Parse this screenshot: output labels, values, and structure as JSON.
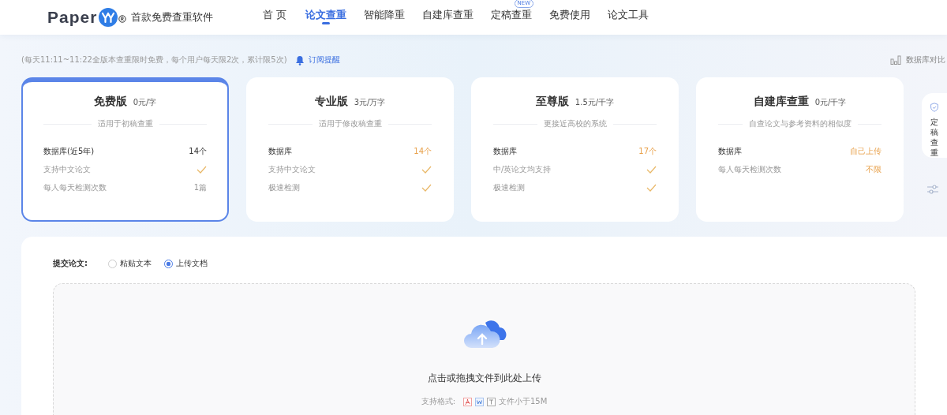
{
  "header": {
    "brand": "Paper",
    "tagline": "首款免费查重软件",
    "nav": [
      {
        "label": "首 页",
        "selected": false
      },
      {
        "label": "论文查重",
        "selected": true
      },
      {
        "label": "智能降重",
        "selected": false
      },
      {
        "label": "自建库查重",
        "selected": false
      },
      {
        "label": "定稿查重",
        "selected": false,
        "badge": "NEW"
      },
      {
        "label": "免费使用",
        "selected": false
      },
      {
        "label": "论文工具",
        "selected": false
      }
    ]
  },
  "notice": {
    "text": "(每天11:11~11:22全版本查重限时免费，每个用户每天限2次，累计限5次)",
    "subscribe": "订阅提醒",
    "compare": "数据库对比"
  },
  "plans": [
    {
      "title": "免费版",
      "price": "0元/字",
      "subtitle": "适用于初稿查重",
      "selected": true,
      "features": [
        {
          "label": "数据库(近5年)",
          "kind": "text",
          "value": "14个",
          "strong": true,
          "highlight": false
        },
        {
          "label": "支持中文论文",
          "kind": "check",
          "strong": false,
          "highlight": false
        },
        {
          "label": "每人每天检测次数",
          "kind": "text",
          "value": "1篇",
          "strong": false,
          "highlight": false
        }
      ]
    },
    {
      "title": "专业版",
      "price": "3元/万字",
      "subtitle": "适用于修改稿查重",
      "selected": false,
      "features": [
        {
          "label": "数据库",
          "kind": "text",
          "value": "14个",
          "strong": true,
          "highlight": true
        },
        {
          "label": "支持中文论文",
          "kind": "check",
          "strong": false,
          "highlight": false
        },
        {
          "label": "极速检测",
          "kind": "check",
          "strong": false,
          "highlight": false
        }
      ]
    },
    {
      "title": "至尊版",
      "price": "1.5元/千字",
      "subtitle": "更接近高校的系统",
      "selected": false,
      "features": [
        {
          "label": "数据库",
          "kind": "text",
          "value": "17个",
          "strong": true,
          "highlight": true
        },
        {
          "label": "中/英论文均支持",
          "kind": "check",
          "strong": false,
          "highlight": false
        },
        {
          "label": "极速检测",
          "kind": "check",
          "strong": false,
          "highlight": false
        }
      ]
    },
    {
      "title": "自建库查重",
      "price": "0元/千字",
      "subtitle": "自查论文与参考资料的相似度",
      "selected": false,
      "features": [
        {
          "label": "数据库",
          "kind": "text",
          "value": "自己上传",
          "strong": true,
          "highlight": true
        },
        {
          "label": "每人每天检测次数",
          "kind": "text",
          "value": "不限",
          "strong": false,
          "highlight": true
        }
      ]
    }
  ],
  "side_panel": {
    "label": "定稿查重"
  },
  "submit": {
    "label": "提交论文:",
    "options": [
      {
        "label": "粘贴文本",
        "selected": false
      },
      {
        "label": "上传文档",
        "selected": true
      }
    ],
    "upload_text": "点击或拖拽文件到此处上传",
    "formats_label": "支持格式:",
    "size_limit": "文件小于15M"
  }
}
